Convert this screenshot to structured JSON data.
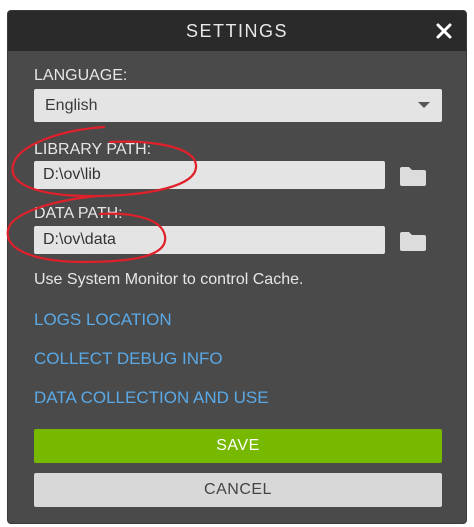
{
  "dialog": {
    "title": "SETTINGS",
    "close_icon": "close-icon"
  },
  "language": {
    "label": "LANGUAGE:",
    "selected": "English"
  },
  "library_path": {
    "label": "LIBRARY PATH:",
    "value": "D:\\ov\\lib",
    "browse_icon": "folder-icon"
  },
  "data_path": {
    "label": "DATA PATH:",
    "value": "D:\\ov\\data",
    "browse_icon": "folder-icon"
  },
  "cache_info": "Use System Monitor to control Cache.",
  "links": {
    "logs_location": "LOGS LOCATION",
    "collect_debug_info": "COLLECT DEBUG INFO",
    "data_collection": "DATA COLLECTION AND USE"
  },
  "buttons": {
    "save": "SAVE",
    "cancel": "CANCEL"
  },
  "colors": {
    "accent": "#76b900",
    "link": "#5aa9e6",
    "annotation": "#e0202a"
  }
}
